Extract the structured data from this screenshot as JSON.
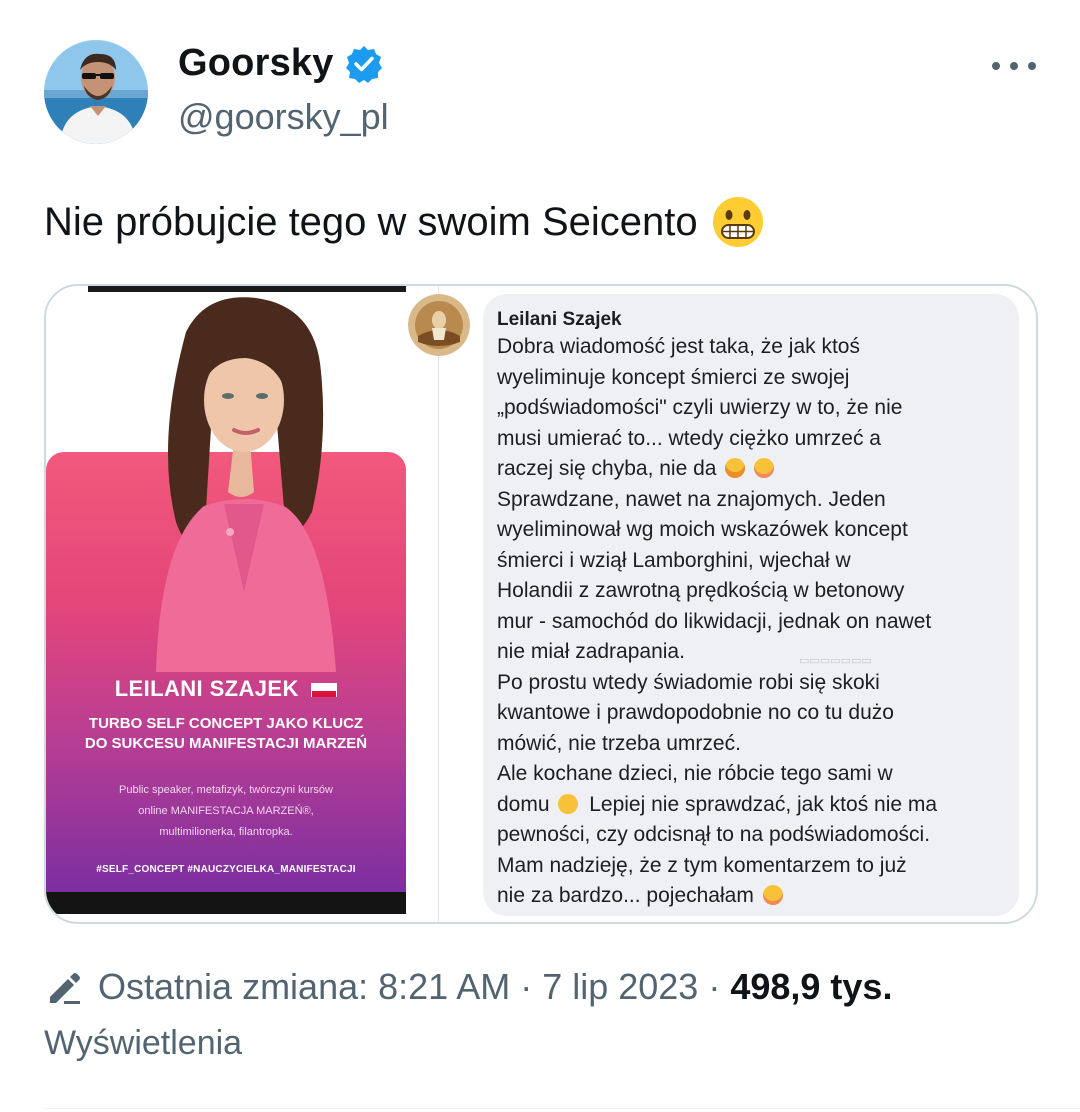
{
  "author": {
    "name": "Goorsky",
    "handle": "@goorsky_pl",
    "verified_icon": "verified-badge-icon",
    "verified_color": "#1d9bf0"
  },
  "more_icon": "more-options-icon",
  "tweet": {
    "text": "Nie próbujcie tego w swoim Seicento",
    "emoji": "grimacing-face-emoji"
  },
  "media": {
    "promo": {
      "name": "LEILANI SZAJEK",
      "subtitle_line1": "TURBO SELF CONCEPT JAKO KLUCZ",
      "subtitle_line2": "DO SUKCESU MANIFESTACJI MARZEŃ",
      "desc_line1": "Public speaker, metafizyk, twórczyni kursów",
      "desc_line2": "online MANIFESTACJA MARZEŃ®,",
      "desc_line3": "multimilionerka, filantropka.",
      "tags": "#SELF_CONCEPT   #NAUCZYCIELKA_MANIFESTACJI",
      "gradient_colors": [
        "#f2597b",
        "#e4457a",
        "#b83e93",
        "#7c2fa1"
      ]
    },
    "comment": {
      "author": "Leilani Szajek",
      "lines": [
        "Dobra wiadomość jest taka, że jak ktoś",
        "wyeliminuje koncept śmierci ze swojej",
        "„podświadomości\" czyli uwierzy w to, że nie",
        "musi umierać to... wtedy ciężko umrzeć a",
        "raczej się chyba, nie da",
        "Sprawdzane, nawet na znajomych. Jeden",
        "wyeliminował wg moich wskazówek koncept",
        "śmierci i wziął Lamborghini, wjechał w",
        "Holandii z zawrotną prędkością w betonowy",
        "mur - samochód do likwidacji, jednak on nawet",
        "nie miał zadrapania.",
        "Po prostu wtedy świadomie robi się skoki",
        "kwantowe i prawdopodobnie no co tu dużo",
        "mówić, nie trzeba umrzeć.",
        "Ale kochane dzieci, nie róbcie tego sami w",
        "domu",
        "Lepiej nie sprawdzać, jak ktoś nie ma",
        "pewności, czy odcisnął to na podświadomości.",
        "Mam nadzieję, że z tym komentarzem to już",
        "nie za bardzo... pojechałam"
      ]
    }
  },
  "footer": {
    "edit_icon": "edit-pencil-icon",
    "label": "Ostatnia zmiana: 8:21 AM · 7 lip 2023 ·",
    "views_count": "498,9 tys.",
    "views_label": "Wyświetlenia"
  }
}
